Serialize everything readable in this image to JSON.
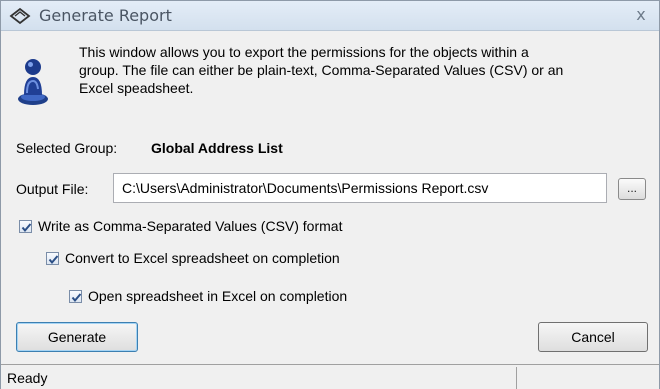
{
  "window": {
    "title": "Generate Report",
    "close_glyph": "x"
  },
  "info": {
    "line1": "This window allows you to export the permissions for the objects within a",
    "line2": "group. The file can either be plain-text, Comma-Separated Values (CSV) or an",
    "line3": "Excel speadsheet."
  },
  "group": {
    "label": "Selected Group:",
    "value": "Global Address List"
  },
  "output": {
    "label": "Output File:",
    "value": "C:\\Users\\Administrator\\Documents\\Permissions Report.csv",
    "browse_label": "..."
  },
  "options": {
    "csv_label": "Write as Comma-Separated Values (CSV) format",
    "csv_checked": true,
    "excel_label": "Convert to Excel spreadsheet on completion",
    "excel_checked": true,
    "open_label": "Open spreadsheet in Excel on completion",
    "open_checked": true
  },
  "buttons": {
    "generate": "Generate",
    "cancel": "Cancel"
  },
  "status": {
    "text": "Ready"
  },
  "icons": {
    "title": "diamond-arrow-icon",
    "info": "user-icon"
  },
  "colors": {
    "title_bg": "#d3e0ee",
    "title_text": "#4a5563",
    "focus_border": "#3c7fb1",
    "check_mark": "#2b4f86"
  }
}
